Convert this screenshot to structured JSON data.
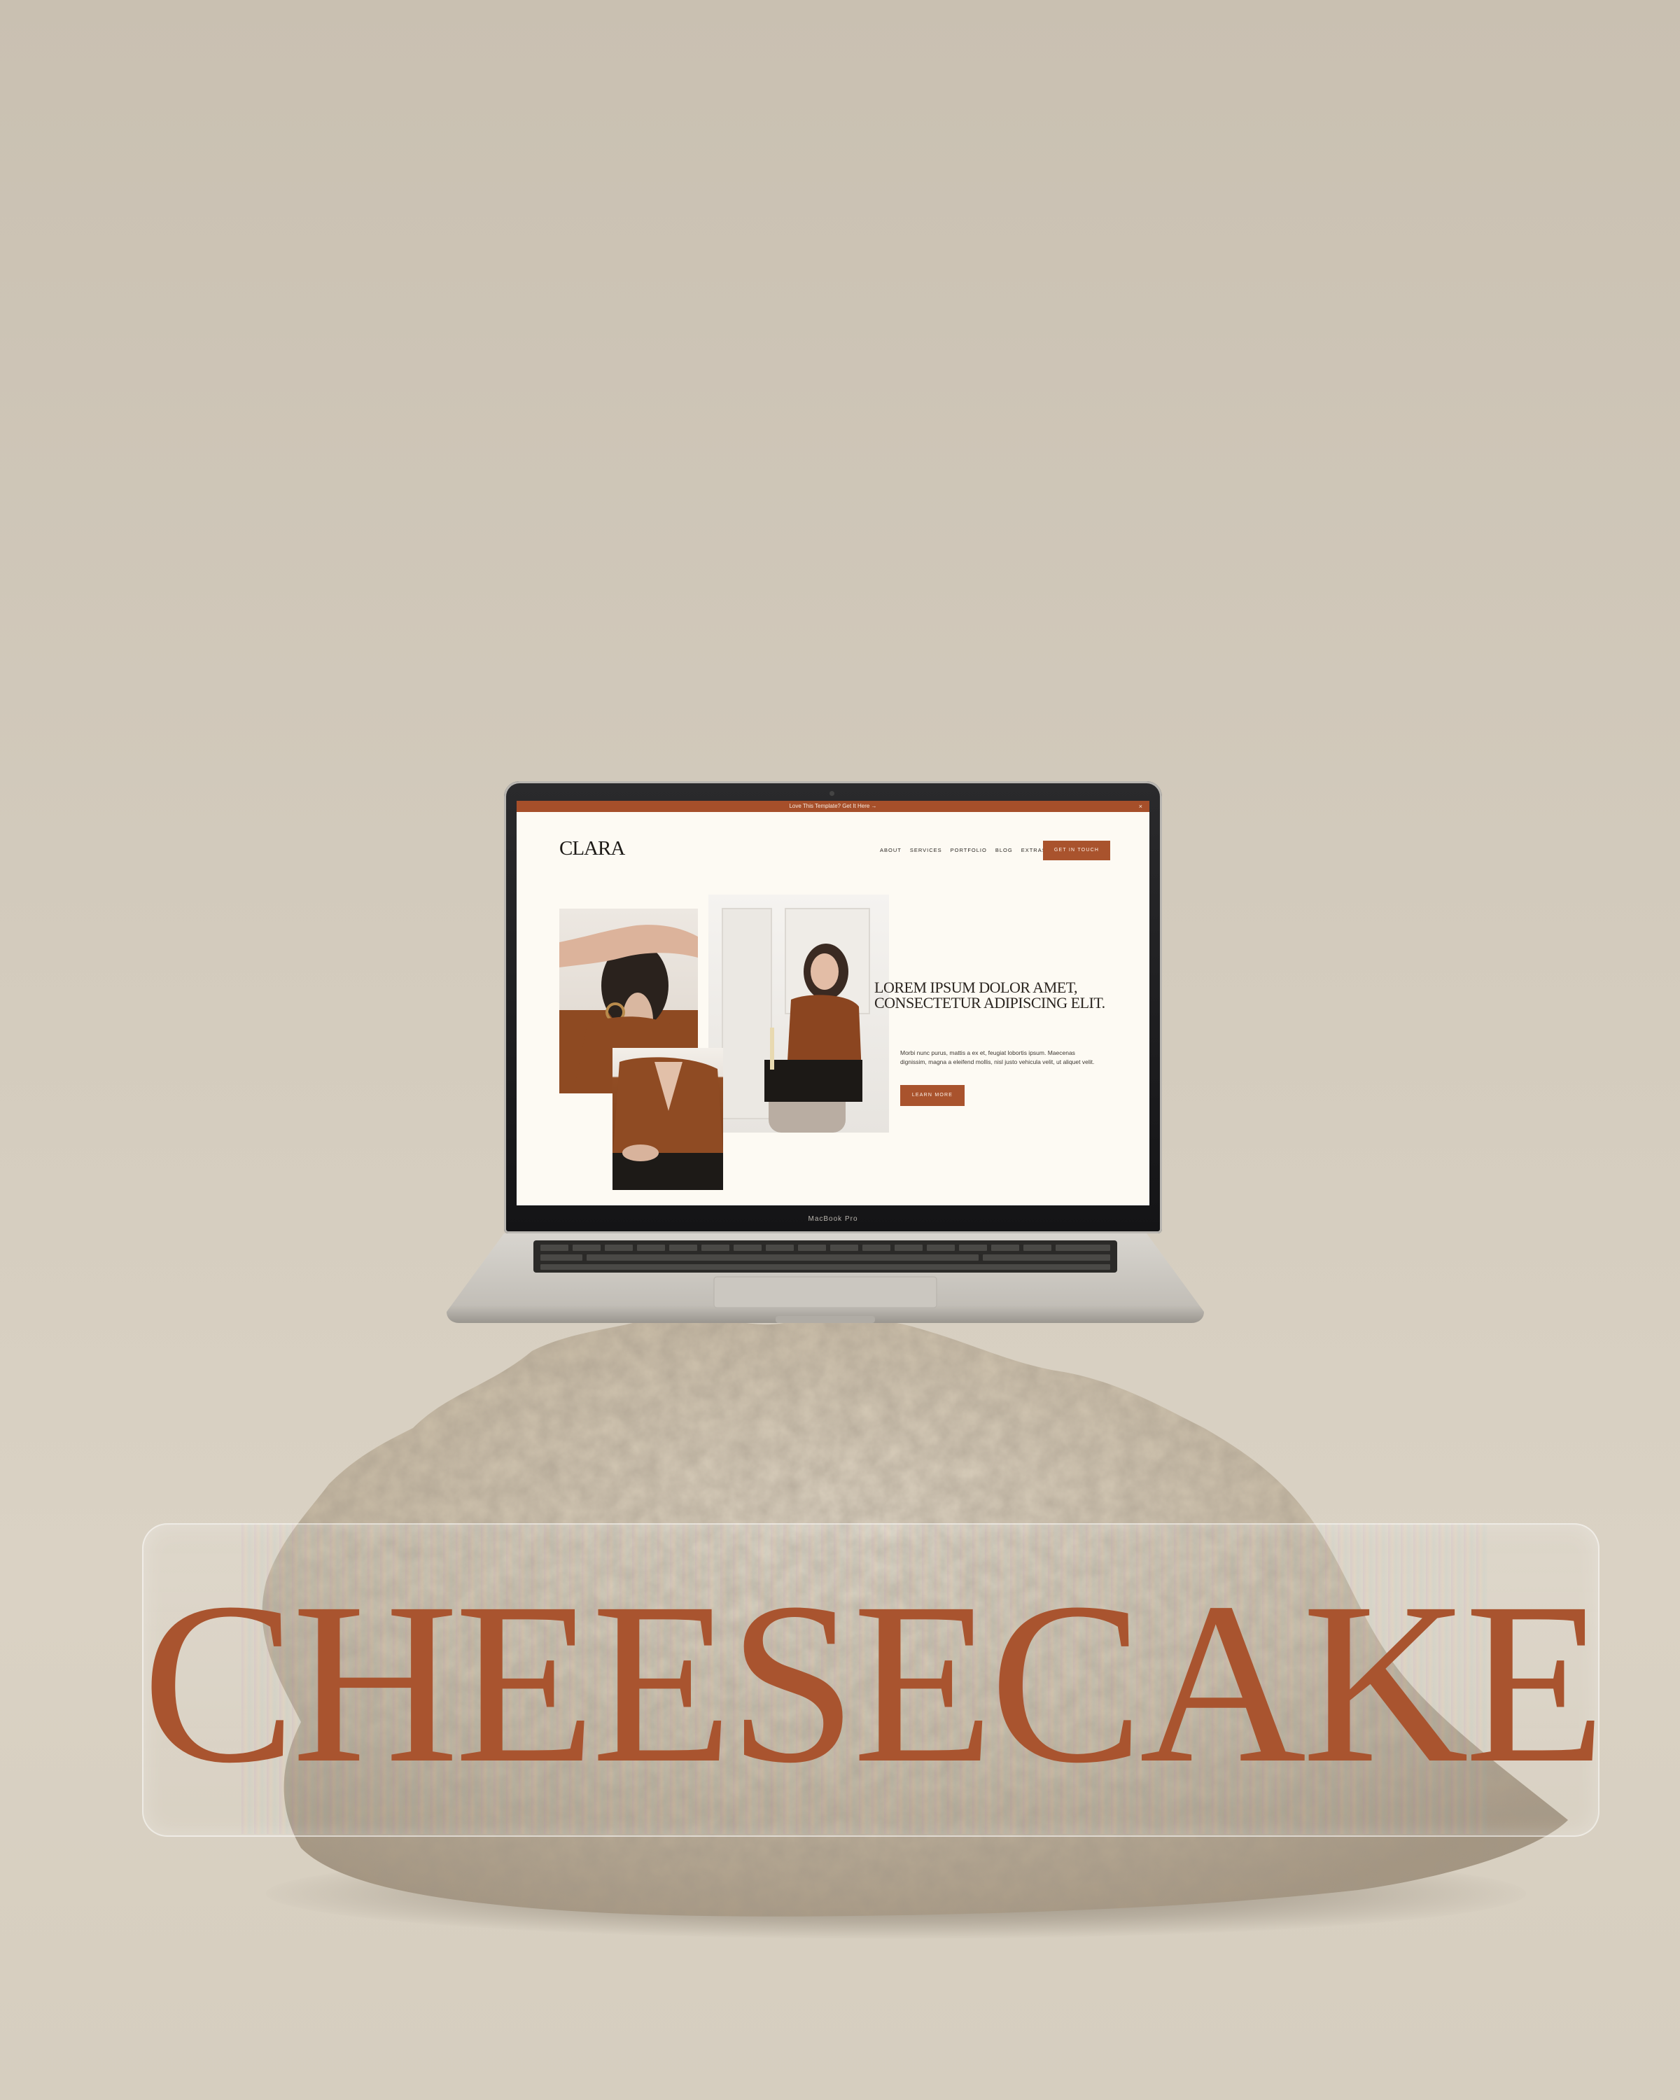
{
  "banner": {
    "text": "CHEESECAKE",
    "color": "#a9542f"
  },
  "laptop": {
    "model_label": "MacBook Pro"
  },
  "website": {
    "announcement": {
      "text": "Love This Template? Get It Here →",
      "close_glyph": "×"
    },
    "brand": "CLARA",
    "nav": [
      {
        "label": "ABOUT"
      },
      {
        "label": "SERVICES"
      },
      {
        "label": "PORTFOLIO"
      },
      {
        "label": "BLOG"
      },
      {
        "label": "EXTRAS"
      }
    ],
    "cta_label": "GET IN TOUCH",
    "hero": {
      "title": "LOREM IPSUM DOLOR AMET, CONSECTETUR ADIPISCING ELIT.",
      "body": "Morbi nunc purus, mattis a ex et, feugiat lobortis ipsum. Maecenas dignissim, magna a eleifend mollis, nisl justo vehicula velit, ut aliquet velit.",
      "button_label": "LEARN MORE"
    },
    "accent_color": "#a9532d",
    "background_color": "#fdfaf3"
  }
}
